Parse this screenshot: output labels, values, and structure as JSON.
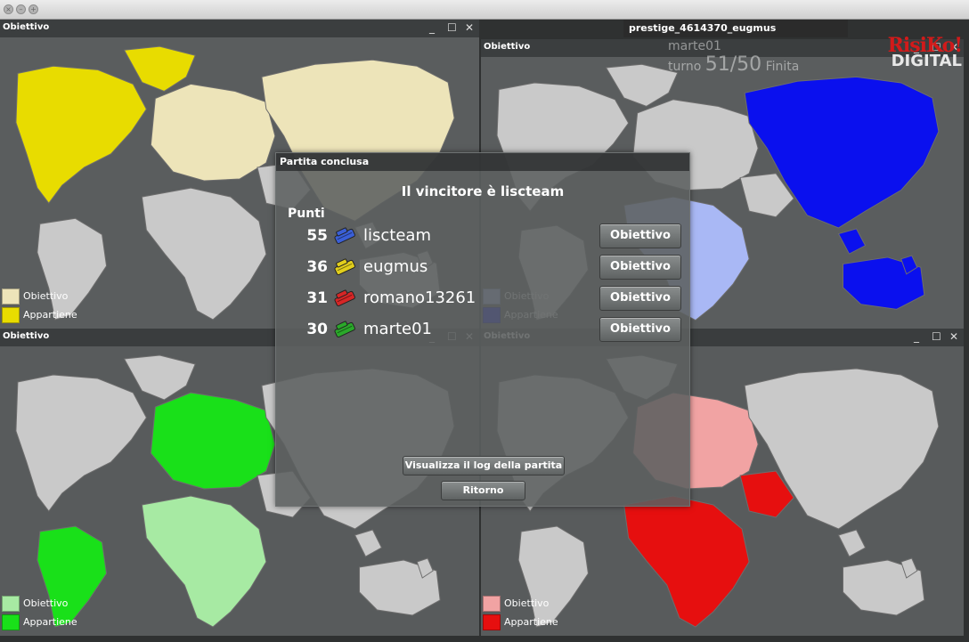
{
  "window": {
    "title": "prestige_4614370_eugmus"
  },
  "logo": {
    "line1": "RisiKo!",
    "line2": "DIGITAL"
  },
  "background_status": {
    "player": "marte01",
    "turn_label": "turno",
    "turn": "51/50",
    "state": "Finita"
  },
  "panes": [
    {
      "id": "top-left",
      "title": "Obiettivo",
      "legend": [
        {
          "label": "Obiettivo",
          "color": "#ede4b9"
        },
        {
          "label": "Appartiene",
          "color": "#e8dc00"
        }
      ]
    },
    {
      "id": "top-right",
      "title": "Obiettivo",
      "legend": [
        {
          "label": "Obiettivo",
          "color": "#a9b8f5"
        },
        {
          "label": "Appartiene",
          "color": "#0a10ee"
        }
      ]
    },
    {
      "id": "bottom-left",
      "title": "Obiettivo",
      "legend": [
        {
          "label": "Obiettivo",
          "color": "#a7eaa3"
        },
        {
          "label": "Appartiene",
          "color": "#19e019"
        }
      ]
    },
    {
      "id": "bottom-right",
      "title": "Obiettivo",
      "legend": [
        {
          "label": "Obiettivo",
          "color": "#f1a3a3"
        },
        {
          "label": "Appartiene",
          "color": "#e60f0f"
        }
      ]
    }
  ],
  "dialog": {
    "title": "Partita conclusa",
    "winner_text": "Il vincitore è liscteam",
    "points_label": "Punti",
    "players": [
      {
        "points": "55",
        "name": "liscteam",
        "color": "#3a5fd6",
        "button": "Obiettivo"
      },
      {
        "points": "36",
        "name": "eugmus",
        "color": "#e2cf1c",
        "button": "Obiettivo"
      },
      {
        "points": "31",
        "name": "romano13261",
        "color": "#d62626",
        "button": "Obiettivo"
      },
      {
        "points": "30",
        "name": "marte01",
        "color": "#2aa82a",
        "button": "Obiettivo"
      }
    ],
    "log_button": "Visualizza il log della partita",
    "back_button": "Ritorno"
  },
  "window_controls": {
    "minimize": "_",
    "maximize": "☐",
    "close": "✕"
  }
}
